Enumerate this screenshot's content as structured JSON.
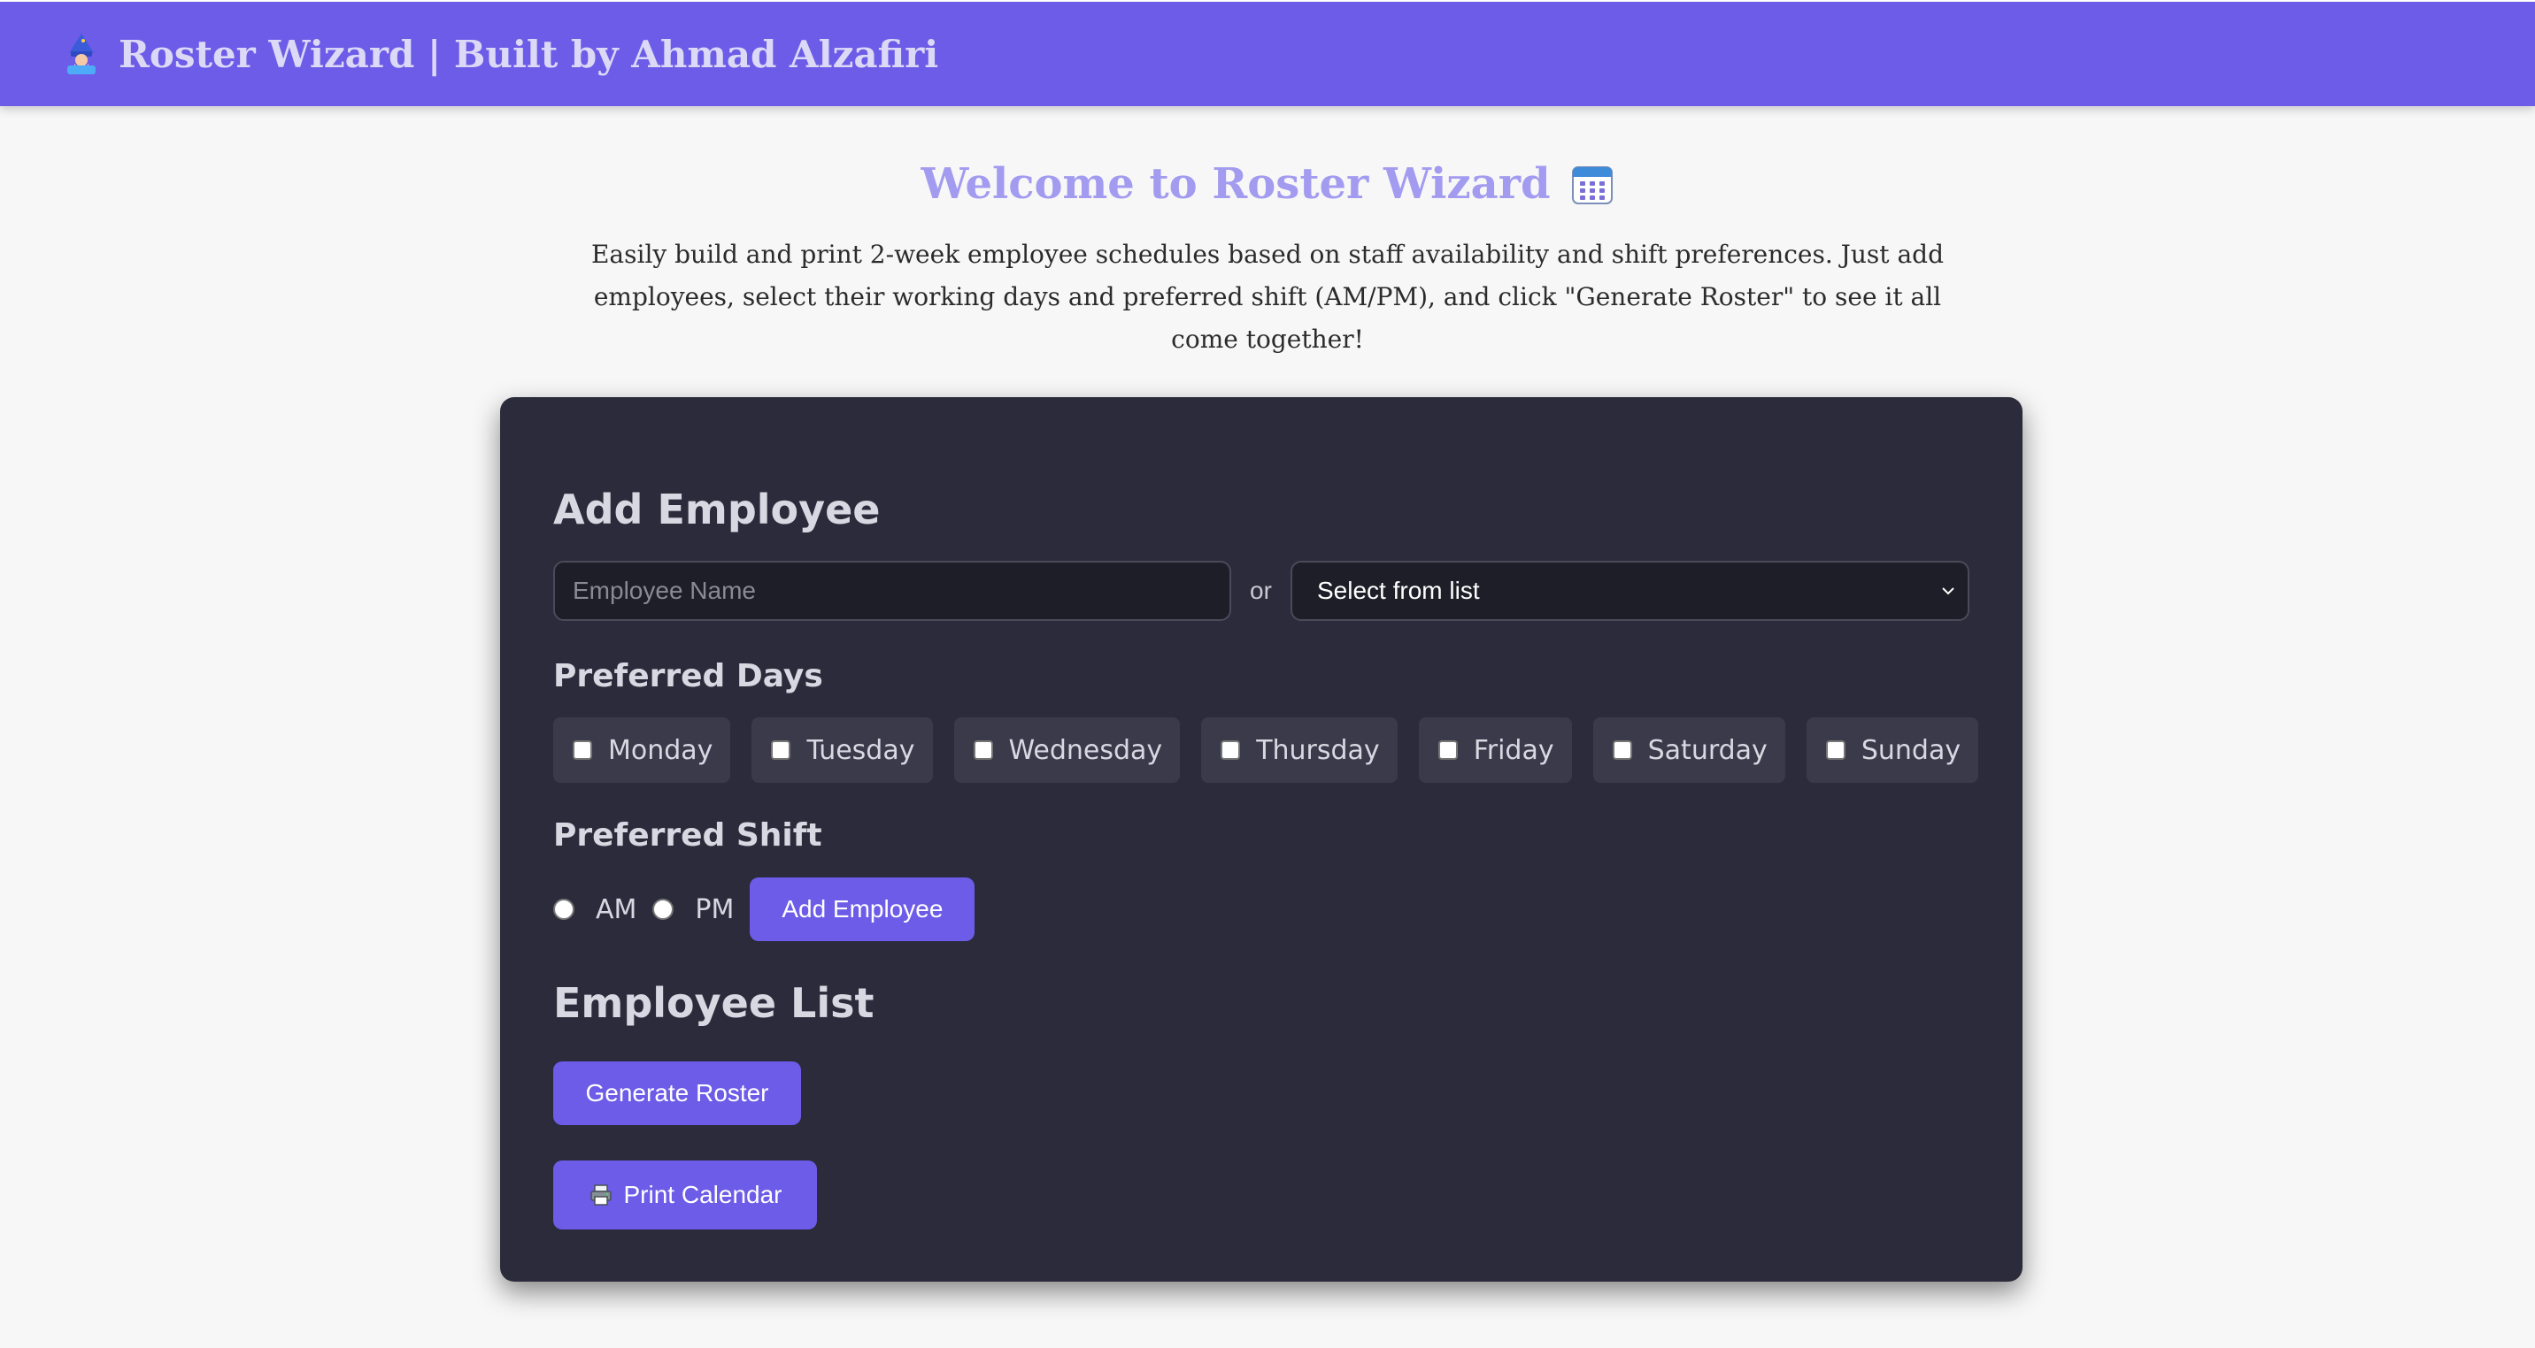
{
  "header": {
    "title": "Roster Wizard | Built by Ahmad Alzafiri",
    "icon": "wizard-icon"
  },
  "intro": {
    "welcome": "Welcome to Roster Wizard",
    "welcome_icon": "calendar-icon",
    "description": "Easily build and print 2-week employee schedules based on staff availability and shift preferences. Just add employees, select their working days and preferred shift (AM/PM), and click \"Generate Roster\" to see it all come together!"
  },
  "form": {
    "add_employee_heading": "Add Employee",
    "name_input": {
      "value": "",
      "placeholder": "Employee Name"
    },
    "or_label": "or",
    "select": {
      "selected": "Select from list"
    },
    "preferred_days_heading": "Preferred Days",
    "days": [
      {
        "label": "Monday",
        "checked": false
      },
      {
        "label": "Tuesday",
        "checked": false
      },
      {
        "label": "Wednesday",
        "checked": false
      },
      {
        "label": "Thursday",
        "checked": false
      },
      {
        "label": "Friday",
        "checked": false
      },
      {
        "label": "Saturday",
        "checked": false
      },
      {
        "label": "Sunday",
        "checked": false
      }
    ],
    "preferred_shift_heading": "Preferred Shift",
    "shifts": [
      {
        "label": "AM",
        "selected": false
      },
      {
        "label": "PM",
        "selected": false
      }
    ],
    "add_button": "Add Employee"
  },
  "employee_list": {
    "heading": "Employee List",
    "generate_button": "Generate Roster",
    "print_button": "Print Calendar",
    "print_icon": "printer-icon"
  },
  "colors": {
    "accent": "#6c5ce7",
    "card_bg": "#2b2b3b",
    "page_bg": "#f7f7f7",
    "welcome_text": "#a29bf0"
  }
}
